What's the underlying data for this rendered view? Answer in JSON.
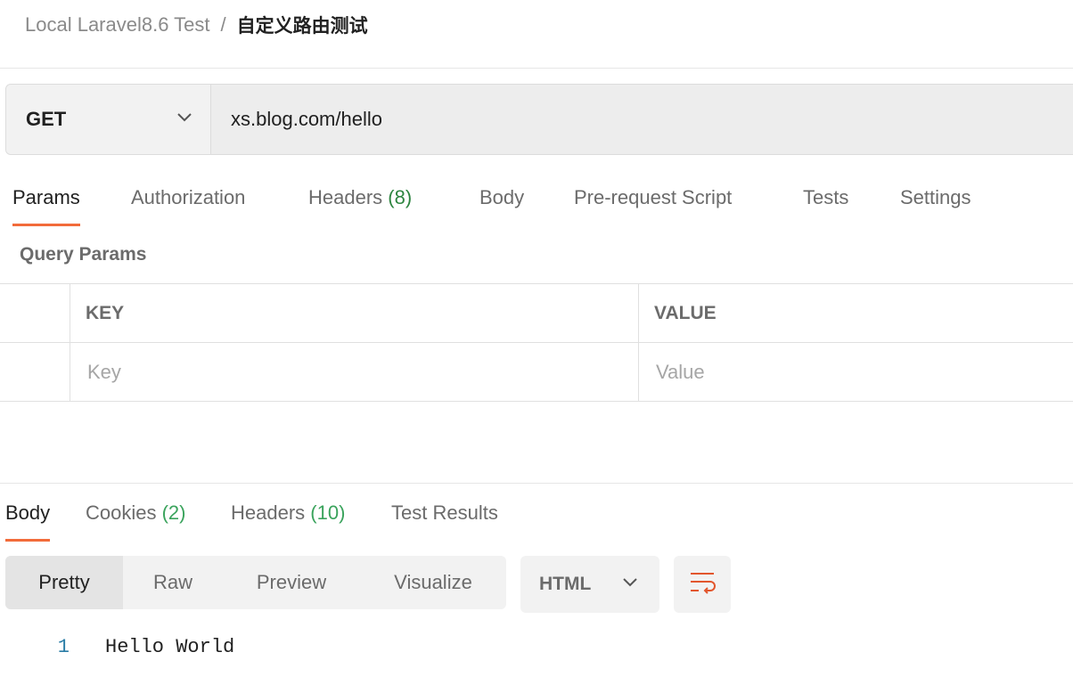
{
  "breadcrumb": {
    "collection": "Local Laravel8.6 Test",
    "separator": "/",
    "request_name": "自定义路由测试"
  },
  "request": {
    "method": "GET",
    "url": "xs.blog.com/hello"
  },
  "request_tabs": [
    {
      "label": "Params",
      "active": true
    },
    {
      "label": "Authorization"
    },
    {
      "label": "Headers",
      "count": "(8)"
    },
    {
      "label": "Body"
    },
    {
      "label": "Pre-request Script"
    },
    {
      "label": "Tests"
    },
    {
      "label": "Settings"
    }
  ],
  "query_params": {
    "title": "Query Params",
    "columns": [
      "KEY",
      "VALUE"
    ],
    "key_placeholder": "Key",
    "value_placeholder": "Value"
  },
  "response_tabs": [
    {
      "label": "Body",
      "active": true
    },
    {
      "label": "Cookies",
      "count": "(2)"
    },
    {
      "label": "Headers",
      "count": "(10)"
    },
    {
      "label": "Test Results"
    }
  ],
  "body_formats": [
    {
      "label": "Pretty",
      "active": true
    },
    {
      "label": "Raw"
    },
    {
      "label": "Preview"
    },
    {
      "label": "Visualize"
    }
  ],
  "language": "HTML",
  "icons": {
    "method_dropdown": "chevron-down-icon",
    "language_dropdown": "chevron-down-icon",
    "wrap": "wrap-lines-icon"
  },
  "colors": {
    "accent": "#f26b3a",
    "count_green": "#2e8540",
    "line_number": "#2a7da6"
  },
  "response_body": [
    {
      "line": "1",
      "text": "Hello World"
    }
  ]
}
